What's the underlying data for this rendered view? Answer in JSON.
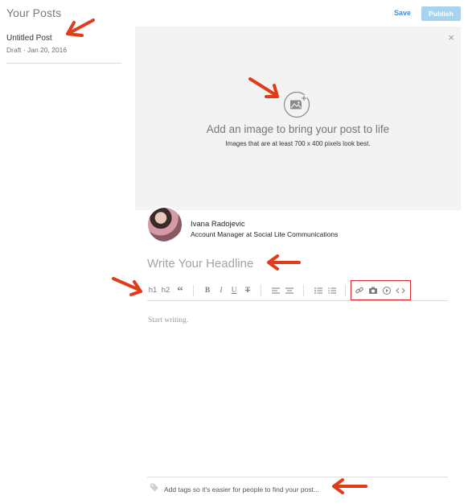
{
  "sidebar": {
    "title": "Your Posts",
    "post": {
      "title": "Untitled Post",
      "meta": "Draft · Jan 20, 2016"
    }
  },
  "actions": {
    "save_label": "Save",
    "publish_label": "Publish"
  },
  "image_area": {
    "heading": "Add an image to bring your post to life",
    "subtext": "Images that are at least 700 x 400 pixels look best.",
    "close_glyph": "×"
  },
  "author": {
    "name": "Ivana Radojevic",
    "title": "Account Manager at Social Lite Communications"
  },
  "editor": {
    "headline_placeholder": "Write Your Headline",
    "body_placeholder": "Start writing.",
    "toolbar": {
      "h1": "h1",
      "h2": "h2",
      "quote": "“",
      "bold": "B",
      "italic": "I",
      "underline": "U",
      "strike": "T"
    }
  },
  "tags": {
    "placeholder": "Add tags so it's easier for people to find your post..."
  },
  "colors": {
    "accent": "#3a8fd6",
    "publish_bg": "#a8d3ef",
    "annotation": "#e23b1a",
    "highlight_box": "#d9242b",
    "image_area_bg": "#f3f3f3"
  },
  "icons": [
    "add-image-icon",
    "close-icon",
    "align-left-icon",
    "align-center-icon",
    "bulleted-list-icon",
    "numbered-list-icon",
    "link-icon",
    "camera-icon",
    "video-play-icon",
    "embed-code-icon",
    "tag-icon"
  ]
}
